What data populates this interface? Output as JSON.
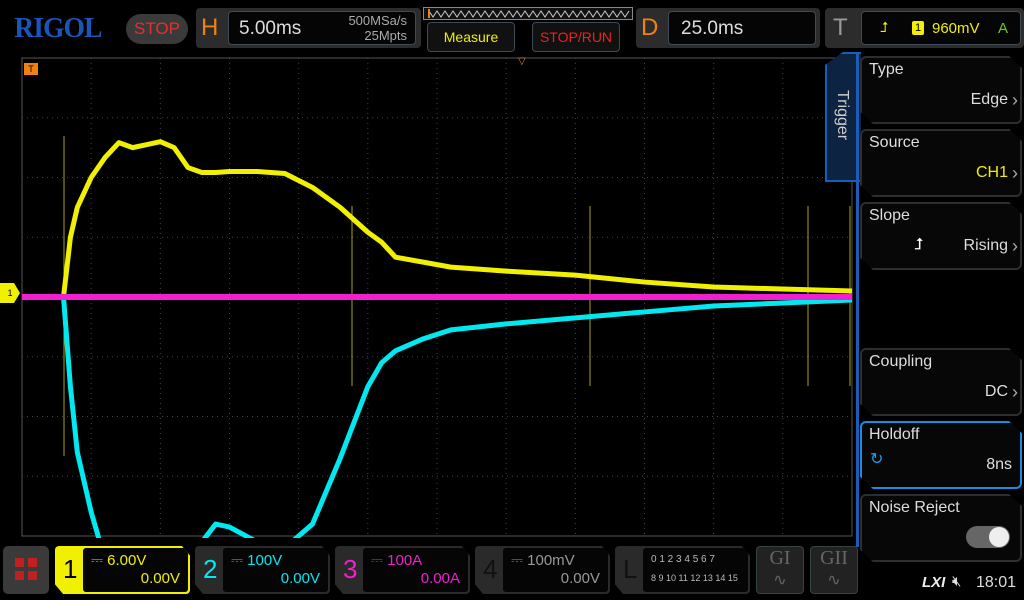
{
  "header": {
    "logo": "RIGOL",
    "status": "STOP",
    "h_label": "H",
    "timebase": "5.00ms",
    "sample_rate": "500MSa/s",
    "memory_depth": "25Mpts",
    "measure_label": "Measure",
    "stoprun_label": "STOP/RUN",
    "d_label": "D",
    "delay": "25.0ms",
    "t_label": "T",
    "trigger_source_badge": "1",
    "trigger_level": "960mV",
    "trigger_mode": "A"
  },
  "trigger_menu": {
    "tab": "Trigger",
    "items": [
      {
        "title": "Type",
        "value": "Edge"
      },
      {
        "title": "Source",
        "value": "CH1"
      },
      {
        "title": "Slope",
        "value": "Rising"
      },
      {
        "title": "Coupling",
        "value": "DC"
      },
      {
        "title": "Holdoff",
        "value": "8ns"
      },
      {
        "title": "Noise Reject",
        "value": ""
      }
    ]
  },
  "markers": {
    "ch1": "1",
    "trigger": "T"
  },
  "channels": [
    {
      "num": "1",
      "scale": "6.00V",
      "offset": "0.00V",
      "color": "#f0f000"
    },
    {
      "num": "2",
      "scale": "100V",
      "offset": "0.00V",
      "color": "#00e8f0"
    },
    {
      "num": "3",
      "scale": "100A",
      "offset": "0.00A",
      "color": "#f020d0"
    },
    {
      "num": "4",
      "scale": "100mV",
      "offset": "0.00V",
      "color": "#888888"
    }
  ],
  "logic": {
    "label": "L",
    "row1": "0 1 2 3  4 5 6 7",
    "row2": "8 9 10 11 12 13 14 15"
  },
  "generators": [
    "GI",
    "GII"
  ],
  "status_bar": {
    "lxi": "LXI",
    "time": "18:01"
  },
  "chart_data": {
    "type": "line",
    "x_unit": "ms",
    "xlim": [
      -5,
      55
    ],
    "series": [
      {
        "name": "CH1",
        "unit": "V",
        "color": "#f0f000",
        "x": [
          -5,
          -2.5,
          -2,
          -1.5,
          -1,
          0,
          1,
          2,
          3,
          4,
          5,
          6,
          7,
          8,
          9,
          10,
          12,
          14,
          16,
          18,
          20,
          21,
          22,
          24,
          26,
          30,
          35,
          40,
          45,
          50,
          55
        ],
        "y": [
          0,
          0,
          0,
          6,
          9,
          12,
          14,
          15.5,
          15,
          15.3,
          15.6,
          15,
          13,
          12.5,
          12.5,
          12.6,
          12.6,
          12.4,
          11,
          9,
          6.5,
          5.5,
          4,
          3.5,
          3,
          2.6,
          2.2,
          1.5,
          1,
          0.8,
          0.6
        ]
      },
      {
        "name": "CH2",
        "unit": "V",
        "color": "#00e8f0",
        "x": [
          -5,
          -2.5,
          -2,
          -1.5,
          -1,
          0,
          1,
          2,
          3,
          4,
          5,
          6,
          7,
          8,
          9,
          10,
          12,
          14,
          16,
          18,
          20,
          21,
          22,
          24,
          26,
          30,
          35,
          40,
          45,
          50,
          55
        ],
        "y": [
          0,
          0,
          0,
          -150,
          -260,
          -360,
          -440,
          -470,
          -470,
          -465,
          -460,
          -455,
          -445,
          -410,
          -380,
          -385,
          -410,
          -420,
          -380,
          -270,
          -150,
          -110,
          -90,
          -70,
          -55,
          -45,
          -35,
          -25,
          -15,
          -10,
          -5
        ]
      },
      {
        "name": "CH3",
        "unit": "A",
        "color": "#f020d0",
        "x": [
          -5,
          55
        ],
        "y": [
          0,
          0
        ]
      }
    ]
  }
}
